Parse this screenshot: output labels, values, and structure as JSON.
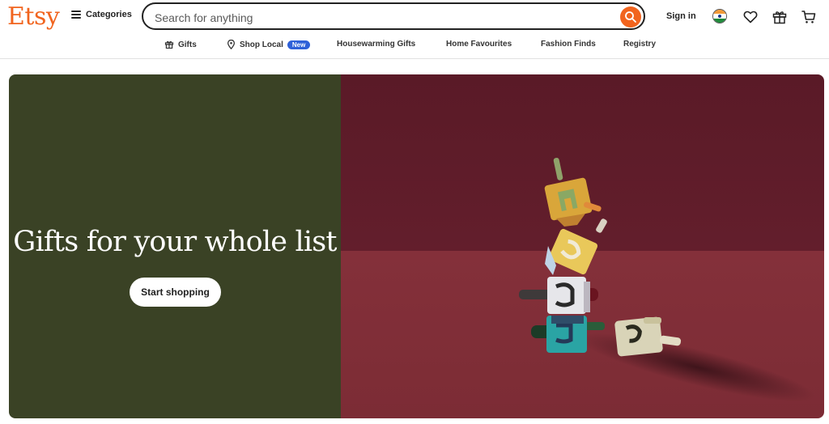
{
  "header": {
    "logo": "Etsy",
    "categories_label": "Categories",
    "search_placeholder": "Search for anything",
    "signin_label": "Sign in"
  },
  "nav": {
    "items": [
      {
        "label": "Gifts",
        "icon": "gift-icon"
      },
      {
        "label": "Shop Local",
        "icon": "location-pin-icon",
        "badge": "New"
      },
      {
        "label": "Housewarming Gifts"
      },
      {
        "label": "Home Favourites"
      },
      {
        "label": "Fashion Finds"
      },
      {
        "label": "Registry"
      }
    ]
  },
  "hero": {
    "title": "Gifts for your whole list",
    "button_label": "Start shopping"
  },
  "icons": [
    "hamburger-icon",
    "search-icon",
    "india-flag-icon",
    "heart-icon",
    "gift-icon",
    "cart-icon"
  ],
  "colors": {
    "brand": "#f1641e",
    "hero_left_bg": "#3a4225",
    "hero_right_bg": "#5e1d2a",
    "badge": "#2f61d8"
  }
}
